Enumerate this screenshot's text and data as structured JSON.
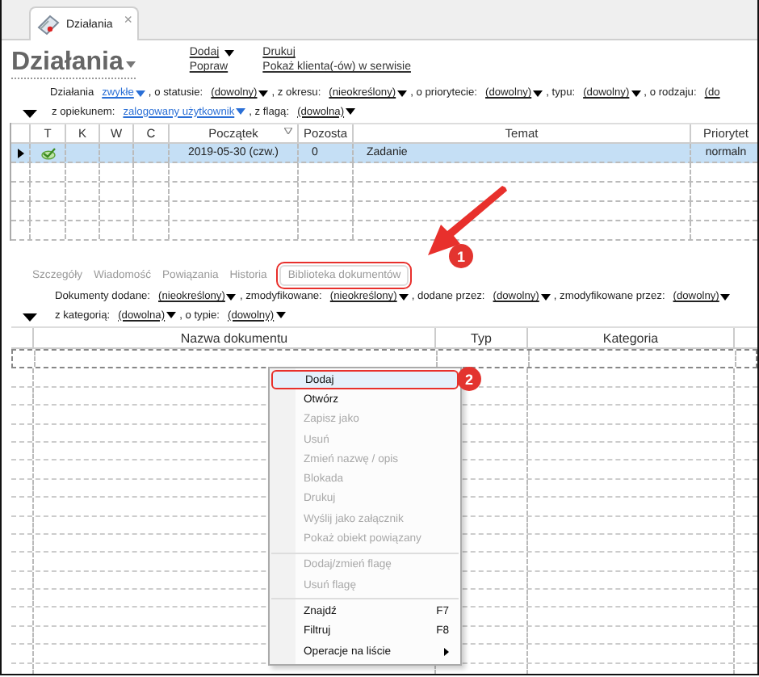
{
  "tab": {
    "title": "Działania",
    "close": "×"
  },
  "header": {
    "title": "Działania",
    "actions": [
      {
        "label": "Dodaj",
        "dropdown": true
      },
      {
        "label": "Popraw",
        "dropdown": false
      },
      {
        "label": "Drukuj",
        "dropdown": false
      },
      {
        "label": "Pokaż klienta(-ów) w serwisie",
        "dropdown": false
      }
    ]
  },
  "filters": [
    [
      {
        "text": "Działania",
        "value": "zwykłe",
        "accent": true,
        "caret": true
      },
      {
        "text": ", o statusie:",
        "value": "(dowolny)",
        "accent": false,
        "caret": true
      },
      {
        "text": ", z okresu:",
        "value": "(nieokreślony)",
        "accent": false,
        "caret": true
      },
      {
        "text": ", o priorytecie:",
        "value": "(dowolny)",
        "accent": false,
        "caret": true
      },
      {
        "text": ", typu:",
        "value": "(dowolny)",
        "accent": false,
        "caret": true
      },
      {
        "text": ", o rodzaju:",
        "value": "(do",
        "accent": false,
        "caret": false
      }
    ],
    [
      {
        "text": "z opiekunem:",
        "value": "zalogowany użytkownik",
        "accent": true,
        "caret": true
      },
      {
        "text": ", z flagą:",
        "value": "(dowolna)",
        "accent": false,
        "caret": true
      }
    ]
  ],
  "grid": {
    "columns": [
      {
        "label": "T",
        "sorted": false
      },
      {
        "label": "K",
        "sorted": false
      },
      {
        "label": "W",
        "sorted": false
      },
      {
        "label": "C",
        "sorted": false
      },
      {
        "label": "Początek",
        "sorted": true
      },
      {
        "label": "Pozosta",
        "sorted": false
      },
      {
        "label": "Temat",
        "sorted": false
      },
      {
        "label": "Priorytet",
        "sorted": false
      }
    ],
    "rows": [
      {
        "selected": true,
        "cells": [
          "",
          "",
          "",
          "",
          "2019-05-30 (czw.)",
          "0",
          "Zadanie",
          "normaln"
        ]
      }
    ]
  },
  "detail_tabs": [
    {
      "label": "Szczegóły",
      "selected": false
    },
    {
      "label": "Wiadomość",
      "selected": false
    },
    {
      "label": "Powiązania",
      "selected": false
    },
    {
      "label": "Historia",
      "selected": false
    },
    {
      "label": "Biblioteka dokumentów",
      "selected": true
    }
  ],
  "doc_filters": [
    [
      {
        "text": "Dokumenty dodane:",
        "value": "(nieokreślony)",
        "accent": false,
        "caret": true
      },
      {
        "text": ", zmodyfikowane:",
        "value": "(nieokreślony)",
        "accent": false,
        "caret": true
      },
      {
        "text": ", dodane przez:",
        "value": "(dowolny)",
        "accent": false,
        "caret": true
      },
      {
        "text": ", zmodyfikowane przez:",
        "value": "(dowolny)",
        "accent": false,
        "caret": true
      }
    ],
    [
      {
        "text": "z kategorią:",
        "value": "(dowolna)",
        "accent": false,
        "caret": true
      },
      {
        "text": ", o typie:",
        "value": "(dowolny)",
        "accent": false,
        "caret": true
      }
    ]
  ],
  "doc_grid": {
    "columns": [
      "Nazwa dokumentu",
      "Typ",
      "Kategoria"
    ]
  },
  "context_menu": {
    "items": [
      {
        "label": "Dodaj",
        "selected": true,
        "disabled": false,
        "separator_before": false
      },
      {
        "label": "Otwórz",
        "selected": false,
        "disabled": false,
        "separator_before": false
      },
      {
        "label": "Zapisz jako",
        "selected": false,
        "disabled": true,
        "separator_before": false
      },
      {
        "label": "Usuń",
        "selected": false,
        "disabled": true,
        "separator_before": false
      },
      {
        "label": "Zmień nazwę / opis",
        "selected": false,
        "disabled": true,
        "separator_before": false
      },
      {
        "label": "Blokada",
        "selected": false,
        "disabled": true,
        "separator_before": false
      },
      {
        "label": "Drukuj",
        "selected": false,
        "disabled": true,
        "separator_before": false
      },
      {
        "label": "Wyślij jako załącznik",
        "selected": false,
        "disabled": true,
        "separator_before": false
      },
      {
        "label": "Pokaż obiekt powiązany",
        "selected": false,
        "disabled": true,
        "separator_before": false
      },
      {
        "label": "Dodaj/zmień flagę",
        "selected": false,
        "disabled": true,
        "separator_before": true
      },
      {
        "label": "Usuń flagę",
        "selected": false,
        "disabled": true,
        "separator_before": false
      },
      {
        "label": "Znajdź",
        "selected": false,
        "disabled": false,
        "separator_before": true,
        "shortcut": "F7"
      },
      {
        "label": "Filtruj",
        "selected": false,
        "disabled": false,
        "separator_before": false,
        "shortcut": "F8"
      },
      {
        "label": "Operacje na liście",
        "selected": false,
        "disabled": false,
        "separator_before": false,
        "submenu": true
      }
    ]
  },
  "callouts": [
    {
      "number": "1"
    },
    {
      "number": "2"
    }
  ]
}
